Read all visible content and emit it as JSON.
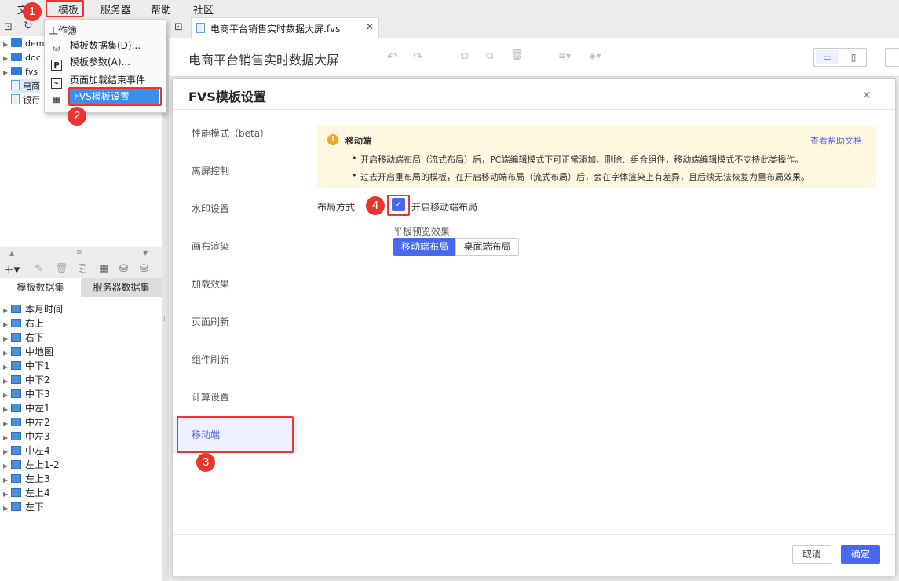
{
  "menubar": {
    "items": [
      "文",
      "模板",
      "服务器",
      "帮助",
      "社区"
    ]
  },
  "dropdown": {
    "section": "工作簿",
    "items": [
      "模板数据集(D)...",
      "模板参数(A)...",
      "页面加载结束事件",
      "FVS模板设置"
    ]
  },
  "file_tree": [
    "dem",
    "doc",
    "fvs",
    "电商",
    "银行"
  ],
  "dataset_tabs": [
    "模板数据集",
    "服务器数据集"
  ],
  "datasets": [
    "本月时间",
    "右上",
    "右下",
    "中地图",
    "中下1",
    "中下2",
    "中下3",
    "中左1",
    "中左2",
    "中左3",
    "中左4",
    "左上1-2",
    "左上3",
    "左上4",
    "左下"
  ],
  "doc_tab": {
    "title": "电商平台销售实时数据大屏.fvs"
  },
  "designer": {
    "title": "电商平台销售实时数据大屏"
  },
  "dialog": {
    "title": "FVS模板设置",
    "sidebar": [
      "性能模式（beta）",
      "离屏控制",
      "水印设置",
      "画布渲染",
      "加载效果",
      "页面刷新",
      "组件刷新",
      "计算设置",
      "移动端"
    ],
    "notice": {
      "title": "移动端",
      "help_link": "查看帮助文档",
      "lines": [
        "开启移动端布局（流式布局）后，PC端编辑模式下可正常添加、删除、组合组件，移动端编辑模式不支持此类操作。",
        "过去开启重布局的模板，在开启移动端布局（流式布局）后，会在字体渲染上有差异，且后续无法恢复为重布局效果。"
      ]
    },
    "layout_label": "布局方式",
    "checkbox_label": "开启移动端布局",
    "tablet_label": "平板预览效果",
    "seg": [
      "移动端布局",
      "桌面端布局"
    ],
    "cancel": "取消",
    "ok": "确定"
  },
  "badges": [
    "1",
    "2",
    "3",
    "4"
  ],
  "colors": {
    "accent": "#4968f0",
    "red": "#e8352e",
    "warn": "#f5a623"
  }
}
